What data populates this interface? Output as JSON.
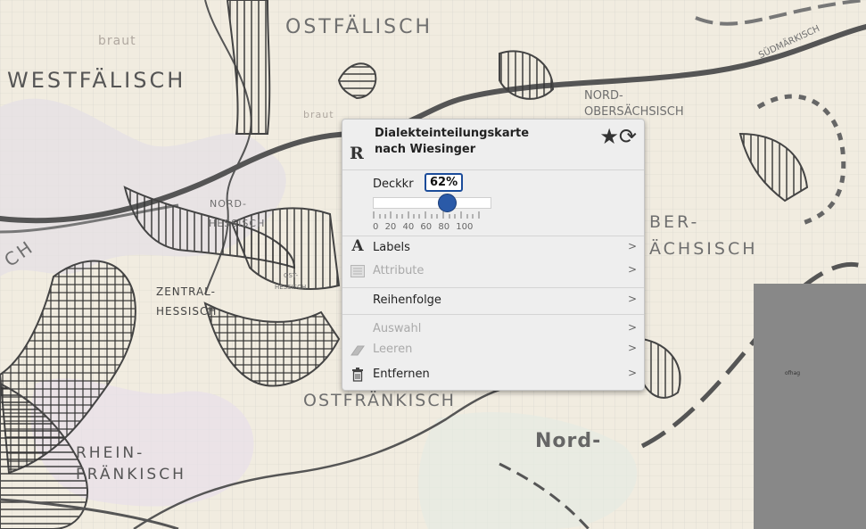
{
  "map": {
    "regions": [
      "OSTFÄLISCH",
      "WESTFÄLISCH",
      "NORD-",
      "OBERSÄCHSISCH",
      "SÜDMÄRKISCH",
      "NORD-",
      "HESSISCH",
      "ZENTRAL-",
      "HESSISCH",
      "OST-",
      "HESSISCH",
      "OSTFRÄNKISCH",
      "RHEIN-",
      "FRÄNKISCH",
      "Nord-",
      "BER-",
      "ÄCHSISCH",
      "CH",
      "braut",
      "braut"
    ],
    "grey_label": "ofhag"
  },
  "layer_menu": {
    "title_line1": "Dialekteinteilungskarte",
    "title_line2": "nach Wiesinger",
    "logo_letter": "R",
    "favorite_icon": "star-icon",
    "refresh_icon": "refresh-icon",
    "opacity_label": "Deckkr",
    "opacity_value": "62%",
    "opacity_fraction": 0.62,
    "tick_labels": [
      "0",
      "20",
      "40",
      "60",
      "80",
      "100"
    ],
    "items": [
      {
        "label": "Labels",
        "icon": "labels-icon",
        "disabled": false
      },
      {
        "label": "Attribute",
        "icon": "table-icon",
        "disabled": true
      },
      {
        "label": "Reihenfolge",
        "icon": "",
        "disabled": false
      },
      {
        "label": "Auswahl",
        "icon": "",
        "disabled": true
      },
      {
        "label": "Leeren",
        "icon": "eraser-icon",
        "disabled": true
      },
      {
        "label": "Entfernen",
        "icon": "trash-icon",
        "disabled": false
      }
    ],
    "chevron": ">"
  }
}
